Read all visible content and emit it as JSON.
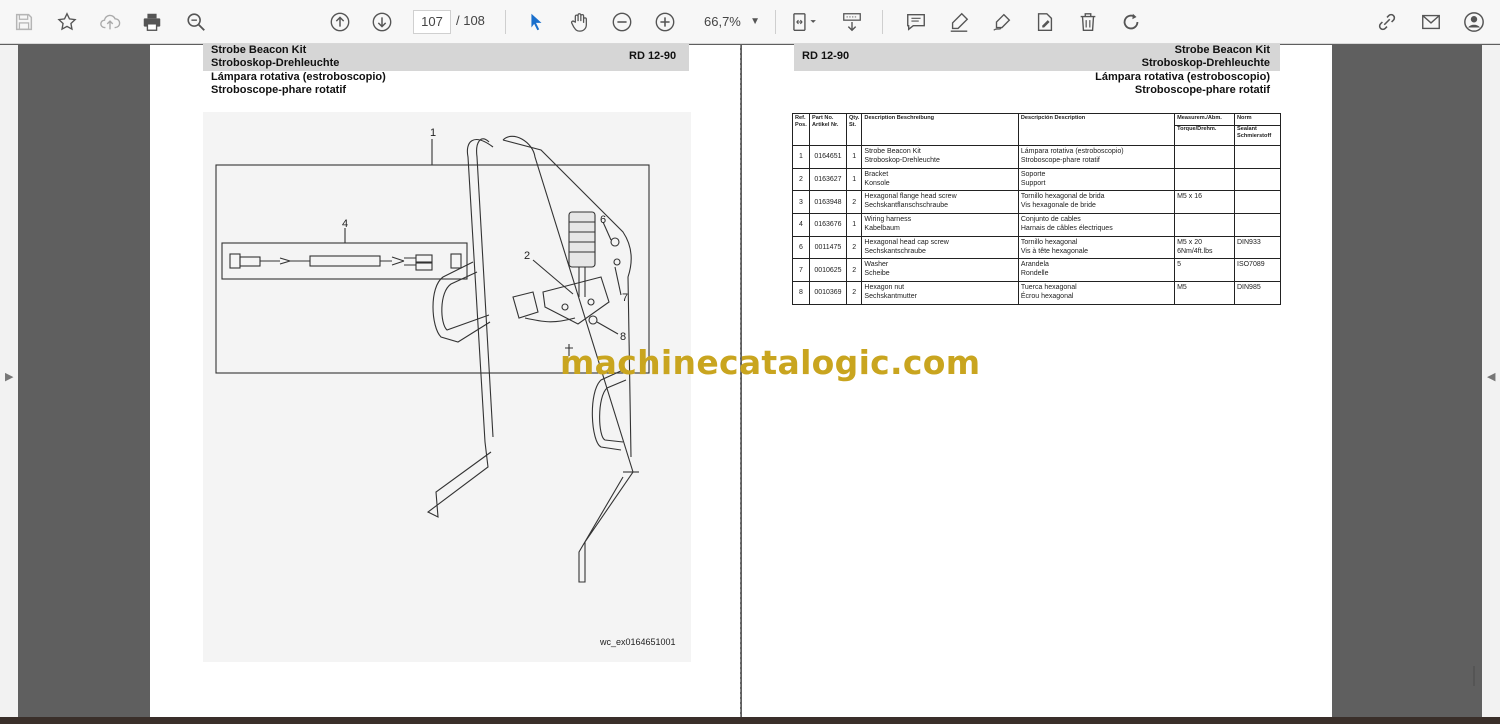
{
  "toolbar": {
    "current_page": "107",
    "total_pages": "/ 108",
    "zoom": "66,7%"
  },
  "left_page": {
    "title_lines": [
      "Strobe Beacon Kit",
      "Stroboskop-Drehleuchte",
      "Lámpara rotativa (estroboscopio)",
      "Stroboscope-phare rotatif"
    ],
    "model_code": "RD 12-90",
    "figure_caption": "wc_ex0164651001",
    "callouts": [
      "1",
      "2",
      "4",
      "6",
      "7",
      "8"
    ]
  },
  "right_page": {
    "title_lines": [
      "Strobe Beacon Kit",
      "Stroboskop-Drehleuchte",
      "Lámpara rotativa (estroboscopio)",
      "Stroboscope-phare rotatif"
    ],
    "model_code": "RD 12-90"
  },
  "table": {
    "headers": {
      "ref": "Ref. Pos.",
      "part_no": "Part No. Artikel Nr.",
      "qty": "Qty. St.",
      "desc": "Description Beschreibung",
      "descripcion": "Descripción Description",
      "measure": "Measurem./Abm.",
      "torque": "Torque/Drehm.",
      "norm": "Norm",
      "sealant": "Sealant Schmierstoff"
    },
    "rows": [
      {
        "ref": "1",
        "part": "0164651",
        "qty": "1",
        "desc1": "Strobe Beacon Kit",
        "desc2": "Stroboskop-Drehleuchte",
        "es": "Lámpara rotativa (estroboscopio)",
        "fr": "Stroboscope-phare rotatif",
        "meas": "",
        "torque": "",
        "norm": ""
      },
      {
        "ref": "2",
        "part": "0163627",
        "qty": "1",
        "desc1": "Bracket",
        "desc2": "Konsole",
        "es": "Soporte",
        "fr": "Support",
        "meas": "",
        "torque": "",
        "norm": ""
      },
      {
        "ref": "3",
        "part": "0163948",
        "qty": "2",
        "desc1": "Hexagonal flange head screw",
        "desc2": "Sechskantflanschschraube",
        "es": "Tornillo hexagonal de brida",
        "fr": "Vis hexagonale de bride",
        "meas": "M5 x 16",
        "torque": "",
        "norm": ""
      },
      {
        "ref": "4",
        "part": "0163676",
        "qty": "1",
        "desc1": "Wiring harness",
        "desc2": "Kabelbaum",
        "es": "Conjunto de cables",
        "fr": "Harnais de câbles électriques",
        "meas": "",
        "torque": "",
        "norm": ""
      },
      {
        "ref": "6",
        "part": "0011475",
        "qty": "2",
        "desc1": "Hexagonal head cap screw",
        "desc2": "Sechskantschraube",
        "es": "Tornillo hexagonal",
        "fr": "Vis à tête hexagonale",
        "meas": "M5 x 20",
        "torque": "6Nm/4ft.lbs",
        "norm": "DIN933"
      },
      {
        "ref": "7",
        "part": "0010625",
        "qty": "2",
        "desc1": "Washer",
        "desc2": "Scheibe",
        "es": "Arandela",
        "fr": "Rondelle",
        "meas": "5",
        "torque": "",
        "norm": "ISO7089"
      },
      {
        "ref": "8",
        "part": "0010369",
        "qty": "2",
        "desc1": "Hexagon nut",
        "desc2": "Sechskantmutter",
        "es": "Tuerca hexagonal",
        "fr": "Écrou hexagonal",
        "meas": "M5",
        "torque": "",
        "norm": "DIN985"
      }
    ]
  },
  "watermark": "machinecatalogic.com",
  "colors": {
    "watermark": "#c9a51f",
    "header_band": "#d6d6d6",
    "viewer_bg": "#5f5f5f",
    "toolbar_bg": "#f7f7f7"
  },
  "icons": [
    "save-icon",
    "bookmark-star-icon",
    "upload-icon",
    "print-icon",
    "zoom-search-icon",
    "page-up-icon",
    "page-down-icon",
    "select-pointer-icon",
    "hand-pan-icon",
    "zoom-out-icon",
    "zoom-in-icon",
    "fit-page-icon",
    "scroll-mode-icon",
    "comment-icon",
    "highlight-pen-icon",
    "draw-icon",
    "sign-icon",
    "delete-icon",
    "rotate-icon",
    "share-link-icon",
    "mail-icon",
    "account-icon"
  ]
}
